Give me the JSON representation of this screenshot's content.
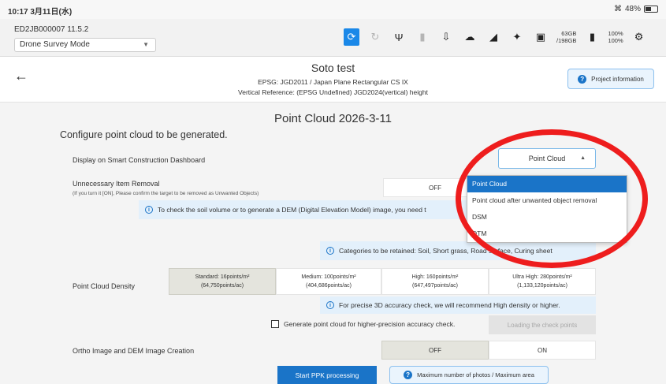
{
  "status_bar": {
    "time": "10:17  3月11日(水)",
    "battery": "48%"
  },
  "toolbar": {
    "device_id": "ED2JB000007   11.5.2",
    "mode_value": "Drone Survey Mode",
    "storage_line1": "63GB",
    "storage_line2": "/198GB",
    "battery_line1": "100%",
    "battery_line2": "100%",
    "accent_color": "#1a88e8"
  },
  "header": {
    "back_icon": "arrow-left-icon",
    "project_title": "Soto test",
    "epsg": "EPSG: JGD2011 / Japan Plane Rectangular CS IX",
    "vertical_reference": "Vertical Reference: (EPSG Undefined) JGD2024(vertical) height",
    "project_info_label": "Project information"
  },
  "main": {
    "title": "Point Cloud 2026-3-11",
    "configure": "Configure point cloud to be generated.",
    "display_label": "Display on Smart Construction Dashboard",
    "display_value": "Point Cloud",
    "removal_label": "Unnecessary Item Removal",
    "removal_sub": "(If you turn it [ON], Please confirm the target to be removed as Unwanted Objects)",
    "removal_off": "OFF",
    "soil_note": "To check the soil volume or to generate a DEM (Digital Elevation Model) image, you need t",
    "categories_note": "Categories to be retained: Soil, Short grass, Road surface, Curing sheet",
    "density_label": "Point Cloud Density",
    "density_options": [
      {
        "line1": "Standard: 16points/m²",
        "line2": "(64,750points/ac)"
      },
      {
        "line1": "Medium: 100points/m²",
        "line2": "(404,686points/ac)"
      },
      {
        "line1": "High: 160points/m²",
        "line2": "(647,497points/ac)"
      },
      {
        "line1": "Ultra High: 280points/m²",
        "line2": "(1,133,120points/ac)"
      }
    ],
    "density_note": "For precise 3D accuracy check, we will recommend High density or higher.",
    "check_label": "Generate point cloud for higher-precision accuracy check.",
    "loading_label": "Loading the check points",
    "ortho_label": "Ortho Image and DEM Image Creation",
    "ortho_off": "OFF",
    "ortho_on": "ON",
    "start_label": "Start PPK processing",
    "max_label": "Maximum number of photos / Maximum area",
    "highlight_color": "#ee1d1d"
  },
  "dropdown": {
    "items": [
      "Point Cloud",
      "Point cloud after unwanted object removal",
      "DSM",
      "DTM"
    ],
    "selected_index": 0
  }
}
